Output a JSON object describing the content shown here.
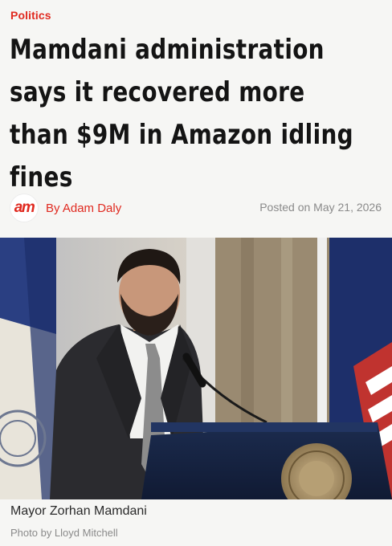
{
  "article": {
    "category": "Politics",
    "headline_lines": [
      "Mamdani administration",
      "says it recovered more",
      "than $9M in Amazon idling",
      "fines"
    ],
    "publisher_logo_text": "am",
    "author": "By Adam Daly",
    "posted": "Posted on May 21, 2026"
  },
  "photo": {
    "caption": "Mayor Zorhan Mamdani",
    "credit": "Photo by Lloyd Mitchell"
  },
  "colors": {
    "accent": "#e02a20",
    "headline": "#141414",
    "muted": "#8a8a8a"
  }
}
